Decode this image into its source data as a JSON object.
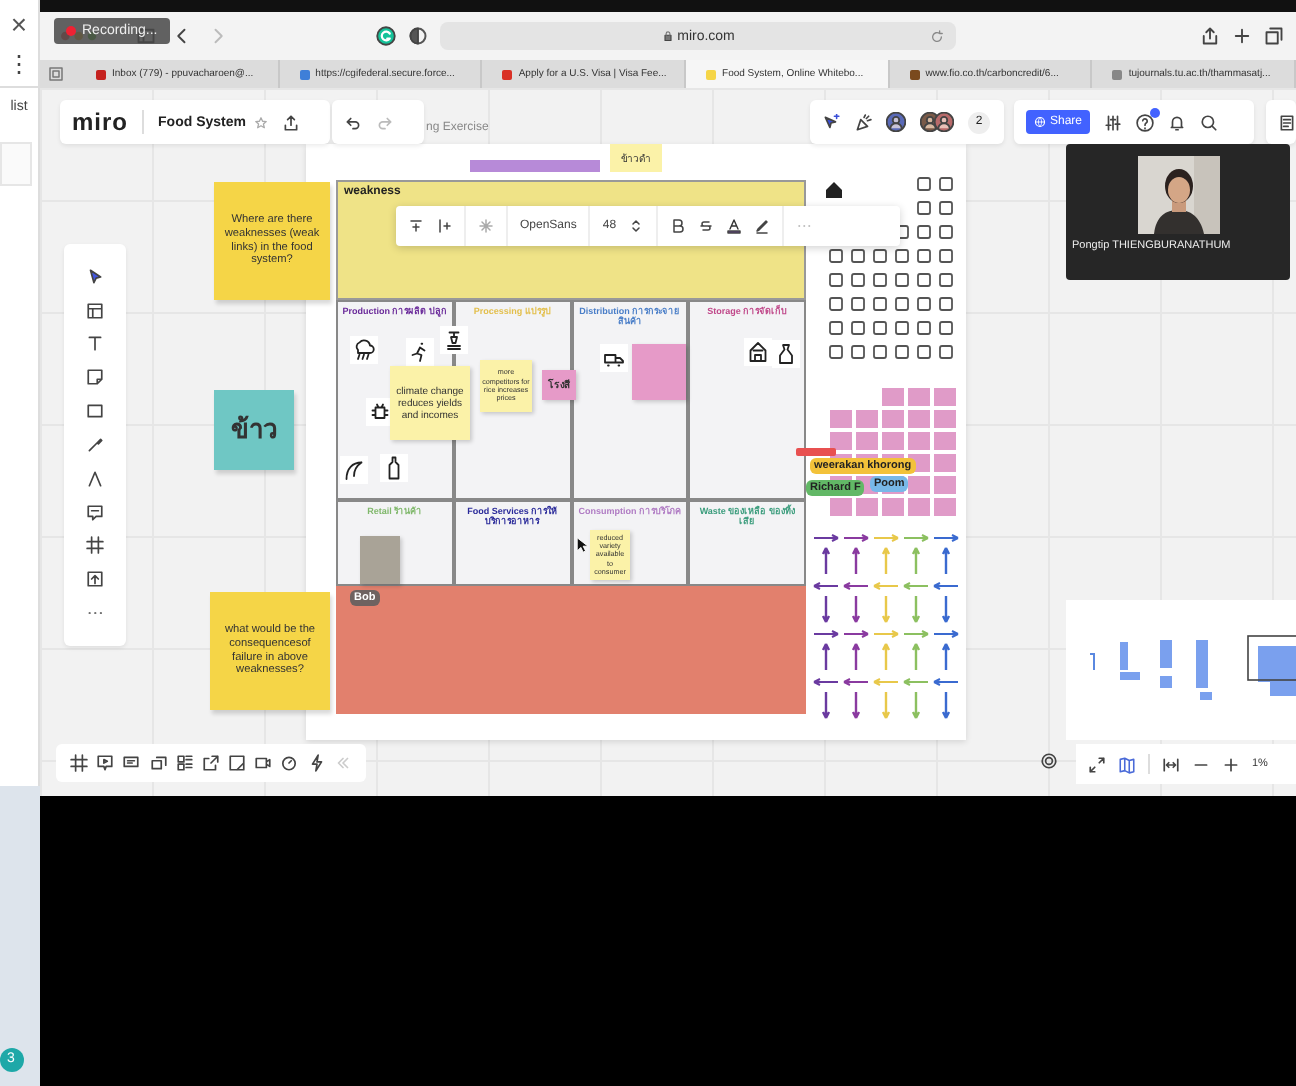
{
  "side_panel": {
    "close": "×",
    "more": "⋮",
    "label": "list",
    "badge": "3"
  },
  "browser": {
    "recording": "Recording...",
    "url": "miro.com",
    "tabs": [
      {
        "label": "Inbox (779) - ppuvacharoen@...",
        "selected": false
      },
      {
        "label": "https://cgifederal.secure.force...",
        "selected": false
      },
      {
        "label": "Apply for a U.S. Visa | Visa Fee...",
        "selected": false
      },
      {
        "label": "Food System, Online Whitebo...",
        "selected": true
      },
      {
        "label": "www.fio.co.th/carboncredit/6...",
        "selected": false
      },
      {
        "label": "tujournals.tu.ac.th/thammasatj...",
        "selected": false
      }
    ]
  },
  "header": {
    "logo": "miro",
    "board_title": "Food System",
    "board_subtitle": "ng Exercise",
    "collaborator_count": "2",
    "share": "Share"
  },
  "board": {
    "notes": [
      {
        "text": "Where are there weaknesses (weak links) in the food system?",
        "color": "#f5d547"
      },
      {
        "text": "ข้าว",
        "color": "#6fc7c4"
      },
      {
        "text": "what would be the consequencesof failure in above weaknesses?",
        "color": "#f5d547"
      }
    ],
    "frame": {
      "tag_note": "ข้าวดำ",
      "title": "weakness",
      "text_toolbar": {
        "font": "OpenSans",
        "size": "48"
      },
      "stages": [
        {
          "name": "Production การผลิต ปลูก",
          "color": "#6a2a9a"
        },
        {
          "name": "Processing แปรรูป",
          "color": "#e3bf4c"
        },
        {
          "name": "Distribution การกระจายสินค้า",
          "color": "#4a7ec8"
        },
        {
          "name": "Storage การจัดเก็บ",
          "color": "#c0488a"
        },
        {
          "name": "Retail ร้านค้า",
          "color": "#80b86c"
        },
        {
          "name": "Food Services การให้บริการอาหาร",
          "color": "#2a2a9a"
        },
        {
          "name": "Consumption การบริโภค",
          "color": "#b07cc4"
        },
        {
          "name": "Waste ของเหลือ ของทิ้งเสีย",
          "color": "#3a9c7c"
        }
      ],
      "notes": [
        {
          "text": "climate change reduces yields and incomes",
          "color": "#fbf2a8"
        },
        {
          "text": "more competitors for rice increases prices",
          "color": "#fbf2a8"
        },
        {
          "text": "โรงสี",
          "color": "#e69ac8"
        },
        {
          "color": "#e69ac8"
        },
        {
          "text": "reduced variety available to consumer",
          "color": "#fbf2a8"
        },
        {
          "color": "#a9a397"
        }
      ]
    },
    "cursors": [
      {
        "name": "weerakan khorong",
        "color": "#f3c23a"
      },
      {
        "name": "Richard F",
        "color": "#62b866"
      },
      {
        "name": "Poom",
        "color": "#78b8e8"
      },
      {
        "name": "Bob",
        "color": "#6e6260"
      }
    ]
  },
  "video": {
    "participant": "Pongtip THIENGBURANATHUM"
  },
  "zoom": "1%"
}
